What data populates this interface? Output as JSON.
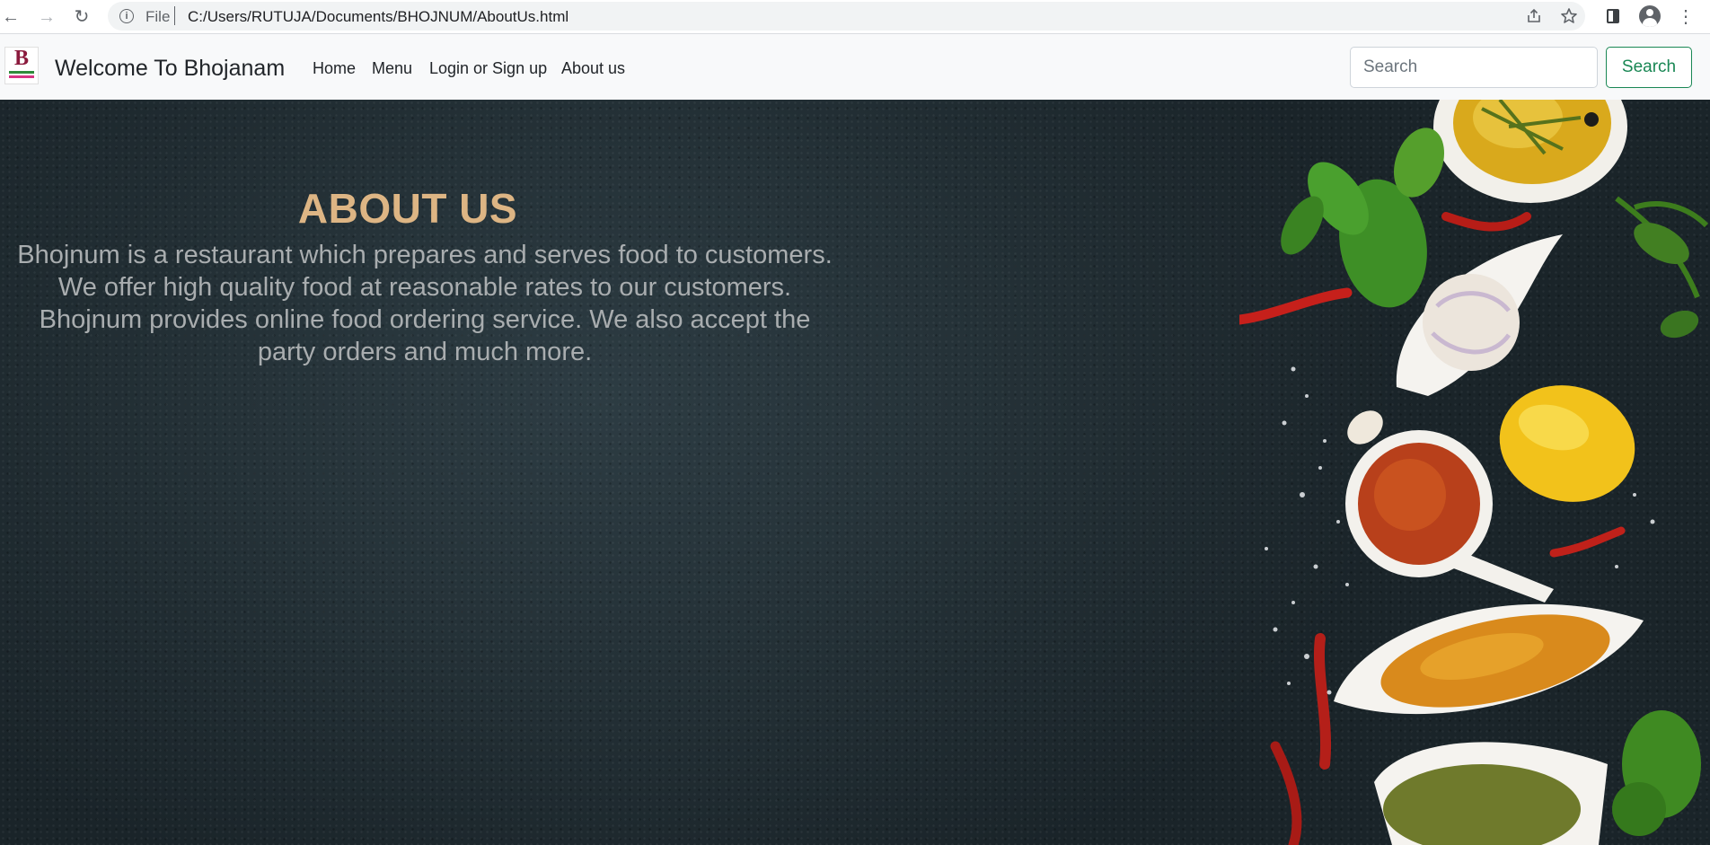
{
  "browser": {
    "scheme_label": "File",
    "url": "C:/Users/RUTUJA/Documents/BHOJNUM/AboutUs.html"
  },
  "navbar": {
    "brand_title": "Welcome To Bhojanam",
    "logo_letter": "B",
    "links": [
      "Home",
      "Menu",
      "Login or Sign up",
      "About us"
    ],
    "search_placeholder": "Search",
    "search_button": "Search",
    "accent_color": "#198754"
  },
  "hero": {
    "title": "ABOUT US",
    "title_color": "#ddb584",
    "description": "Bhojnum is a restaurant which prepares and serves food to customers. We offer high quality food at reasonable rates to our customers. Bhojnum provides online food ordering service. We also accept the party orders and much more."
  }
}
